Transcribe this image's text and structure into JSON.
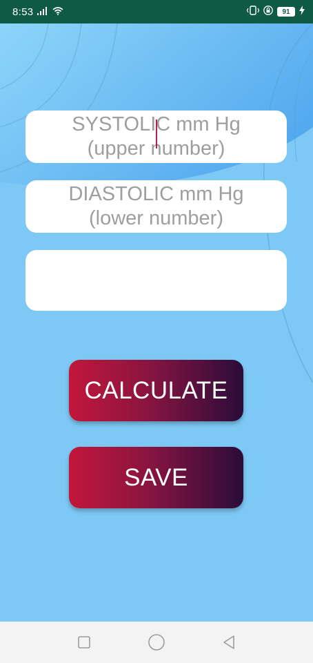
{
  "status_bar": {
    "time": "8:53",
    "battery_level": "91",
    "icons": [
      "signal-icon",
      "wifi-icon",
      "vibrate-icon",
      "lock-icon",
      "battery-icon",
      "charging-icon"
    ]
  },
  "form": {
    "systolic_placeholder": "SYSTOLIC mm Hg\n(upper number)",
    "diastolic_placeholder": "DIASTOLIC mm Hg\n(lower number)",
    "result_value": ""
  },
  "buttons": {
    "calculate_label": "CALCULATE",
    "save_label": "SAVE"
  },
  "nav": {
    "icons": [
      "recent-apps-icon",
      "home-icon",
      "back-icon"
    ]
  },
  "colors": {
    "status_bar": "#0e5a45",
    "background": "#7dc8f4",
    "button_gradient_start": "#c2173a",
    "button_gradient_end": "#2a0c3a",
    "placeholder": "#9e9e9e",
    "caret": "#c2185b"
  }
}
